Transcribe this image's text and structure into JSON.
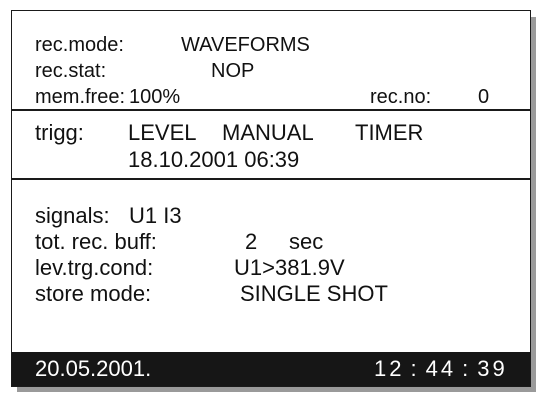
{
  "recording": {
    "mode_label": "rec.mode:",
    "mode_value": "WAVEFORMS",
    "stat_label": "rec.stat:",
    "stat_value": "NOP",
    "mem_label": "mem.free:",
    "mem_value": "100%",
    "recno_label": "rec.no:",
    "recno_value": "0"
  },
  "trigger": {
    "label": "trigg:",
    "options": [
      "LEVEL",
      "MANUAL",
      "TIMER"
    ],
    "datetime": "18.10.2001 06:39"
  },
  "settings": {
    "signals_label": "signals:",
    "signals_value": "U1 I3",
    "buffer_label": "tot. rec. buff:",
    "buffer_value": "2",
    "buffer_unit": "sec",
    "trigcond_label": "lev.trg.cond:",
    "trigcond_value": "U1>381.9V",
    "storemode_label": "store mode:",
    "storemode_value": "SINGLE SHOT"
  },
  "status_bar": {
    "date": "20.05.2001.",
    "time_h": "12",
    "time_m": "44",
    "time_s": "39",
    "sep": ":"
  },
  "colors": {
    "status_bar_bg": "#161616",
    "text": "#111111",
    "frame_shadow": "#9a9a9a"
  }
}
